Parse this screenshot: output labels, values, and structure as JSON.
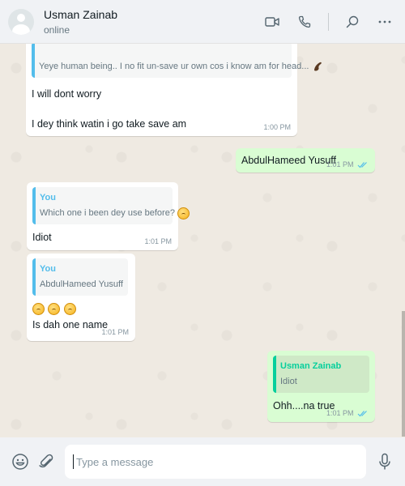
{
  "header": {
    "contact_name": "Usman Zainab",
    "status": "online",
    "actions": [
      "video-call-icon",
      "voice-call-icon",
      "search-icon",
      "menu-icon"
    ]
  },
  "messages": [
    {
      "direction": "incoming",
      "quote_text": "Yeye human being.. I no fit un-save ur own cos i know am for head...",
      "lines": [
        "I will dont worry",
        "I dey think watin i go take save am"
      ],
      "time": "1:00 PM"
    },
    {
      "direction": "outgoing",
      "text": "AbdulHameed Yusuff",
      "time": "1:01 PM",
      "status": "read"
    },
    {
      "direction": "incoming",
      "quote_sender": "You",
      "quote_text": "Which one i been dey use before?",
      "text": "Idiot",
      "time": "1:01 PM"
    },
    {
      "direction": "incoming",
      "quote_sender": "You",
      "quote_text": "AbdulHameed Yusuff",
      "emojis": 3,
      "text": "Is dah one name",
      "time": "1:01 PM"
    },
    {
      "direction": "outgoing",
      "quote_sender": "Usman Zainab",
      "quote_text": "Idiot",
      "text": "Ohh....na true",
      "time": "1:01 PM",
      "status": "read"
    }
  ],
  "composer": {
    "placeholder": "Type a message",
    "icons": [
      "emoji-icon",
      "attach-icon",
      "mic-icon"
    ]
  },
  "colors": {
    "header_bg": "#f0f2f5",
    "chat_bg": "#efeae2",
    "incoming_bubble": "#ffffff",
    "outgoing_bubble": "#d9fdd3",
    "quote_you": "#53bdeb",
    "quote_contact": "#06cf9c",
    "read_ticks": "#53bdeb"
  }
}
